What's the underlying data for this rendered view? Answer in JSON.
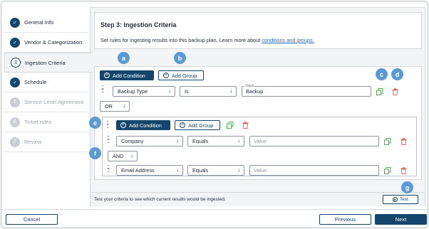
{
  "sidebar": {
    "steps": [
      {
        "label": "General Info",
        "marker": "✓",
        "state": "done"
      },
      {
        "label": "Vendor & Categorization",
        "marker": "✓",
        "state": "done"
      },
      {
        "label": "Ingestion Criteria",
        "marker": "3",
        "state": "current"
      },
      {
        "label": "Schedule",
        "marker": "✓",
        "state": "done"
      },
      {
        "label": "Service Level Agreement",
        "marker": "5",
        "state": "pending"
      },
      {
        "label": "Ticket rules",
        "marker": "6",
        "state": "pending"
      },
      {
        "label": "Review",
        "marker": "7",
        "state": "pending"
      }
    ]
  },
  "header": {
    "title": "Step 3: Ingestion Criteria",
    "description": "Set rules for ingesting results into this backup plan. Learn more about ",
    "link": "conditions and groups."
  },
  "criteria": {
    "add_condition_label": "Add Condition",
    "add_group_label": "Add Group",
    "row1": {
      "field": "Backup Type",
      "operator": "Is",
      "value_label": "Value",
      "value": "Backup"
    },
    "logic1": "OR",
    "group": {
      "add_condition_label": "Add Condition",
      "add_group_label": "Add Group",
      "row1": {
        "field": "Company",
        "operator": "Equals",
        "value_placeholder": "Value"
      },
      "logic": "AND",
      "row2": {
        "field": "Email Address",
        "operator": "Equals",
        "value_placeholder": "Value"
      }
    }
  },
  "callouts": {
    "a": "a",
    "b": "b",
    "c": "c",
    "d": "d",
    "e": "e",
    "f": "f",
    "g": "g"
  },
  "test_bar": {
    "text": "Test your criteria to see which current results would be ingested.",
    "button": "Test"
  },
  "footer": {
    "cancel": "Cancel",
    "previous": "Previous",
    "next": "Next"
  },
  "colors": {
    "primary": "#14456b",
    "callout": "#5a9bd5",
    "delete": "#e0685a",
    "copy": "#4caf50",
    "link": "#1f6bb4"
  },
  "icons": {
    "drag": "drag-handle-icon",
    "copy": "copy-icon",
    "delete": "trash-icon",
    "chevron": "chevron-down-icon",
    "add": "plus-circle-icon",
    "play": "play-circle-icon",
    "check": "check-icon"
  }
}
